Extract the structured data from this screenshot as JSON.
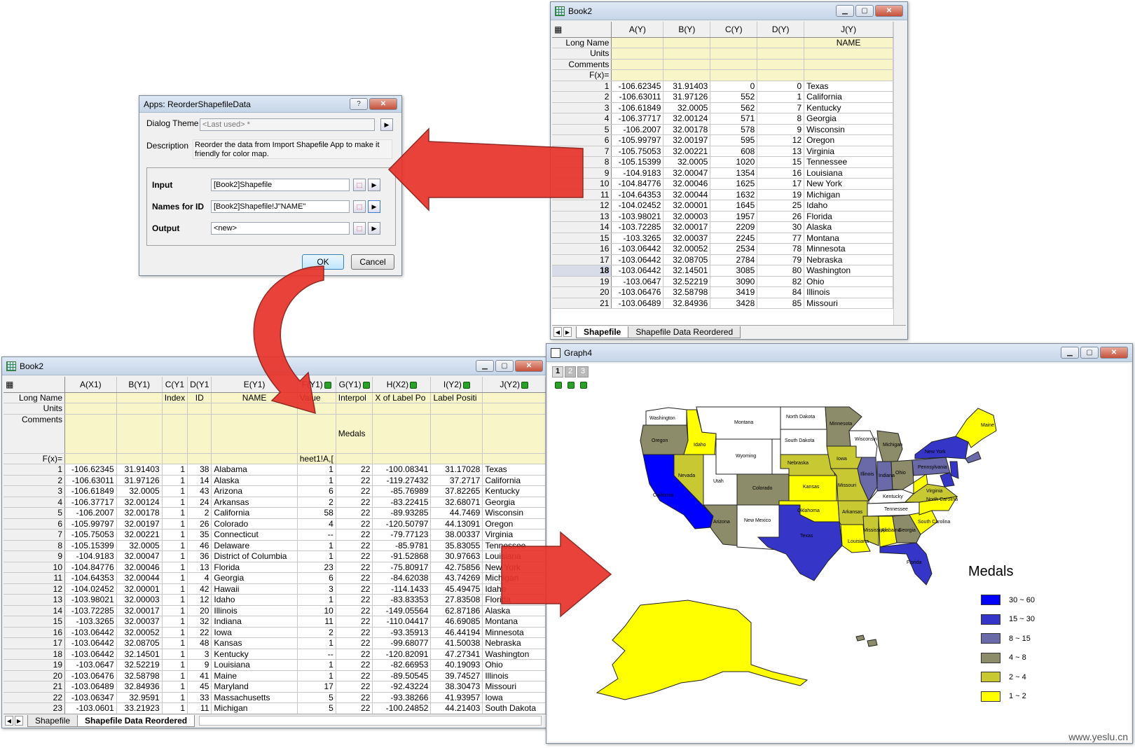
{
  "book2_top": {
    "title": "Book2",
    "columns": [
      "A(Y)",
      "B(Y)",
      "C(Y)",
      "D(Y)",
      "J(Y)"
    ],
    "meta_labels": [
      "Long Name",
      "Units",
      "Comments",
      "F(x)="
    ],
    "long_name_j": "NAME",
    "rows": [
      [
        "1",
        "-106.62345",
        "31.91403",
        "0",
        "0",
        "Texas"
      ],
      [
        "2",
        "-106.63011",
        "31.97126",
        "552",
        "1",
        "California"
      ],
      [
        "3",
        "-106.61849",
        "32.0005",
        "562",
        "7",
        "Kentucky"
      ],
      [
        "4",
        "-106.37717",
        "32.00124",
        "571",
        "8",
        "Georgia"
      ],
      [
        "5",
        "-106.2007",
        "32.00178",
        "578",
        "9",
        "Wisconsin"
      ],
      [
        "6",
        "-105.99797",
        "32.00197",
        "595",
        "12",
        "Oregon"
      ],
      [
        "7",
        "-105.75053",
        "32.00221",
        "608",
        "13",
        "Virginia"
      ],
      [
        "8",
        "-105.15399",
        "32.0005",
        "1020",
        "15",
        "Tennessee"
      ],
      [
        "9",
        "-104.9183",
        "32.00047",
        "1354",
        "16",
        "Louisiana"
      ],
      [
        "10",
        "-104.84776",
        "32.00046",
        "1625",
        "17",
        "New York"
      ],
      [
        "11",
        "-104.64353",
        "32.00044",
        "1632",
        "19",
        "Michigan"
      ],
      [
        "12",
        "-104.02452",
        "32.00001",
        "1645",
        "25",
        "Idaho"
      ],
      [
        "13",
        "-103.98021",
        "32.00003",
        "1957",
        "26",
        "Florida"
      ],
      [
        "14",
        "-103.72285",
        "32.00017",
        "2209",
        "30",
        "Alaska"
      ],
      [
        "15",
        "-103.3265",
        "32.00037",
        "2245",
        "77",
        "Montana"
      ],
      [
        "16",
        "-103.06442",
        "32.00052",
        "2534",
        "78",
        "Minnesota"
      ],
      [
        "17",
        "-103.06442",
        "32.08705",
        "2784",
        "79",
        "Nebraska"
      ],
      [
        "18",
        "-103.06442",
        "32.14501",
        "3085",
        "80",
        "Washington"
      ],
      [
        "19",
        "-103.0647",
        "32.52219",
        "3090",
        "82",
        "Ohio"
      ],
      [
        "20",
        "-103.06476",
        "32.58798",
        "3419",
        "84",
        "Illinois"
      ],
      [
        "21",
        "-103.06489",
        "32.84936",
        "3428",
        "85",
        "Missouri"
      ]
    ],
    "tabs": [
      "Shapefile",
      "Shapefile Data Reordered"
    ]
  },
  "dialog": {
    "title": "Apps: ReorderShapefileData",
    "help": "?",
    "theme_label": "Dialog Theme",
    "theme_value": "<Last used> *",
    "description_label": "Description",
    "description_text": "Reorder the data from Import Shapefile App to make it friendly for color map.",
    "input_label": "Input",
    "input_value": "[Book2]Shapefile",
    "names_label": "Names for ID",
    "names_value": "[Book2]Shapefile!J\"NAME\"",
    "output_label": "Output",
    "output_value": "<new>",
    "ok": "OK",
    "cancel": "Cancel"
  },
  "book2_bottom": {
    "title": "Book2",
    "columns": [
      "A(X1)",
      "B(Y1)",
      "C(Y1",
      "D(Y1",
      "E(Y1)",
      "F(Y1)",
      "G(Y1)",
      "H(X2)",
      "I(Y2)",
      "J(Y2)"
    ],
    "long_names": [
      "",
      "",
      "Index",
      "ID",
      "NAME",
      "Value",
      "Interpol",
      "X of Label Po",
      "Label Positi",
      ""
    ],
    "comments_g": "Medals",
    "fx_f": "heet1!A,[",
    "meta_labels": [
      "Long Name",
      "Units",
      "Comments",
      "F(x)="
    ],
    "rows": [
      [
        "1",
        "-106.62345",
        "31.91403",
        "1",
        "38",
        "Alabama",
        "1",
        "22",
        "-100.08341",
        "31.17028",
        "Texas"
      ],
      [
        "2",
        "-106.63011",
        "31.97126",
        "1",
        "14",
        "Alaska",
        "1",
        "22",
        "-119.27432",
        "37.2717",
        "California"
      ],
      [
        "3",
        "-106.61849",
        "32.0005",
        "1",
        "43",
        "Arizona",
        "6",
        "22",
        "-85.76989",
        "37.82265",
        "Kentucky"
      ],
      [
        "4",
        "-106.37717",
        "32.00124",
        "1",
        "24",
        "Arkansas",
        "2",
        "22",
        "-83.22415",
        "32.68071",
        "Georgia"
      ],
      [
        "5",
        "-106.2007",
        "32.00178",
        "1",
        "2",
        "California",
        "58",
        "22",
        "-89.93285",
        "44.7469",
        "Wisconsin"
      ],
      [
        "6",
        "-105.99797",
        "32.00197",
        "1",
        "26",
        "Colorado",
        "4",
        "22",
        "-120.50797",
        "44.13091",
        "Oregon"
      ],
      [
        "7",
        "-105.75053",
        "32.00221",
        "1",
        "35",
        "Connecticut",
        "--",
        "22",
        "-79.77123",
        "38.00337",
        "Virginia"
      ],
      [
        "8",
        "-105.15399",
        "32.0005",
        "1",
        "46",
        "Delaware",
        "1",
        "22",
        "-85.9781",
        "35.83055",
        "Tennessee"
      ],
      [
        "9",
        "-104.9183",
        "32.00047",
        "1",
        "36",
        "District of Columbia",
        "1",
        "22",
        "-91.52868",
        "30.97663",
        "Louisiana"
      ],
      [
        "10",
        "-104.84776",
        "32.00046",
        "1",
        "13",
        "Florida",
        "23",
        "22",
        "-75.80917",
        "42.75856",
        "New York"
      ],
      [
        "11",
        "-104.64353",
        "32.00044",
        "1",
        "4",
        "Georgia",
        "6",
        "22",
        "-84.62038",
        "43.74269",
        "Michigan"
      ],
      [
        "12",
        "-104.02452",
        "32.00001",
        "1",
        "42",
        "Hawaii",
        "3",
        "22",
        "-114.1433",
        "45.49475",
        "Idaho"
      ],
      [
        "13",
        "-103.98021",
        "32.00003",
        "1",
        "12",
        "Idaho",
        "1",
        "22",
        "-83.83353",
        "27.83508",
        "Florida"
      ],
      [
        "14",
        "-103.72285",
        "32.00017",
        "1",
        "20",
        "Illinois",
        "10",
        "22",
        "-149.05564",
        "62.87186",
        "Alaska"
      ],
      [
        "15",
        "-103.3265",
        "32.00037",
        "1",
        "32",
        "Indiana",
        "11",
        "22",
        "-110.04417",
        "46.69085",
        "Montana"
      ],
      [
        "16",
        "-103.06442",
        "32.00052",
        "1",
        "22",
        "Iowa",
        "2",
        "22",
        "-93.35913",
        "46.44194",
        "Minnesota"
      ],
      [
        "17",
        "-103.06442",
        "32.08705",
        "1",
        "48",
        "Kansas",
        "1",
        "22",
        "-99.68077",
        "41.50038",
        "Nebraska"
      ],
      [
        "18",
        "-103.06442",
        "32.14501",
        "1",
        "3",
        "Kentucky",
        "--",
        "22",
        "-120.82091",
        "47.27341",
        "Washington"
      ],
      [
        "19",
        "-103.0647",
        "32.52219",
        "1",
        "9",
        "Louisiana",
        "1",
        "22",
        "-82.66953",
        "40.19093",
        "Ohio"
      ],
      [
        "20",
        "-103.06476",
        "32.58798",
        "1",
        "41",
        "Maine",
        "1",
        "22",
        "-89.50545",
        "39.74527",
        "Illinois"
      ],
      [
        "21",
        "-103.06489",
        "32.84936",
        "1",
        "45",
        "Maryland",
        "17",
        "22",
        "-92.43224",
        "38.30473",
        "Missouri"
      ],
      [
        "22",
        "-103.06347",
        "32.9591",
        "1",
        "33",
        "Massachusetts",
        "5",
        "22",
        "-93.38266",
        "41.93957",
        "Iowa"
      ],
      [
        "23",
        "-103.0601",
        "33.21923",
        "1",
        "11",
        "Michigan",
        "5",
        "22",
        "-100.24852",
        "44.21403",
        "South Dakota"
      ]
    ],
    "tabs": [
      "Shapefile",
      "Shapefile Data Reordered"
    ]
  },
  "graph": {
    "title": "Graph4",
    "layers": [
      "1",
      "2",
      "3"
    ],
    "legend_title": "Medals",
    "legend": [
      {
        "label": "30 ~ 60",
        "color": "#0000ff"
      },
      {
        "label": "15 ~ 30",
        "color": "#3535c8"
      },
      {
        "label": "8   ~ 15",
        "color": "#6a6aa8"
      },
      {
        "label": "4   ~ 8",
        "color": "#8c8c6a"
      },
      {
        "label": "2   ~ 4",
        "color": "#c8c832"
      },
      {
        "label": "1   ~ 2",
        "color": "#ffff00"
      }
    ],
    "state_labels": [
      "Washington",
      "Montana",
      "North Dakota",
      "Minnesota",
      "Oregon",
      "South Dakota",
      "Wisconsin",
      "Michigan",
      "Wyoming",
      "Idaho",
      "Nebraska",
      "Iowa",
      "New York",
      "Nevada",
      "Utah",
      "Colorado",
      "Illinois",
      "Indiana",
      "Ohio",
      "Pennsylvania",
      "Kansas",
      "Missouri",
      "Kentucky",
      "California",
      "Arizona",
      "New Mexico",
      "Oklahoma",
      "Arkansas",
      "Tennessee",
      "North Carolina",
      "South Carolina",
      "Texas",
      "Mississippi",
      "Alabama",
      "Georgia",
      "Louisiana",
      "Florida",
      "Maine",
      "Virginia"
    ]
  },
  "watermark": "www.yeslu.cn"
}
